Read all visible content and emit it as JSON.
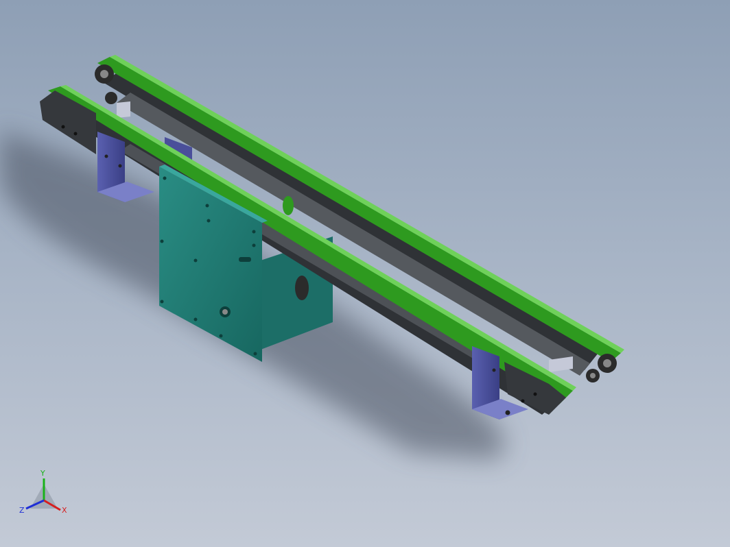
{
  "viewport": {
    "background_top": "#8e9fb5",
    "background_bottom": "#c3cad6"
  },
  "model": {
    "belt_color": "#2e9a1f",
    "frame_color": "#3a3d40",
    "bracket_color": "#4a4f9a",
    "motor_plate_color": "#1f7a72",
    "shaft_color": "#c5c9d8"
  },
  "triad": {
    "y_label": "Y",
    "x_label": "X",
    "z_label": "Z",
    "y_color": "#19b219",
    "x_color": "#d61f1f",
    "z_color": "#1f2fd6"
  }
}
